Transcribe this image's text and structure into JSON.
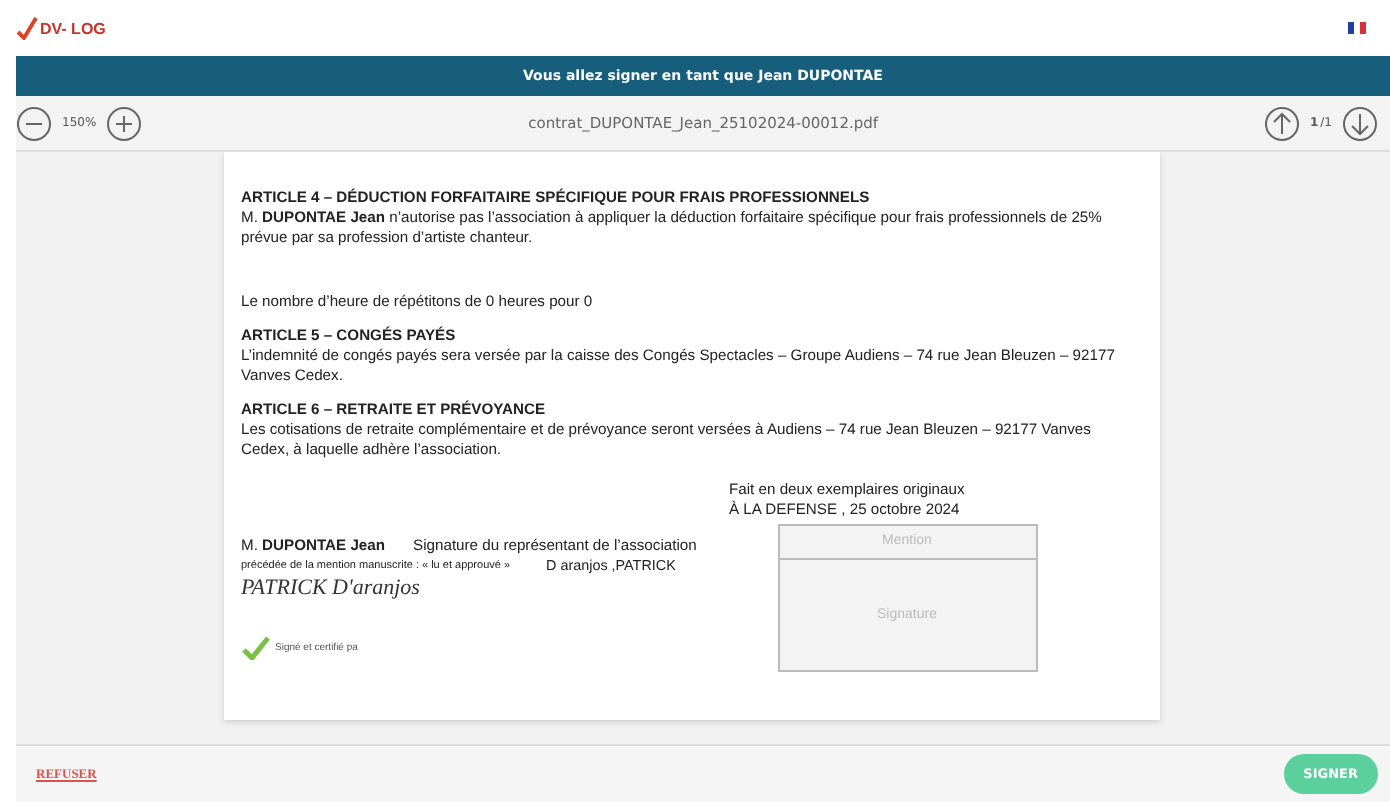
{
  "header": {
    "logo": "DV- LOG"
  },
  "banner": {
    "text": "Vous allez signer en tant que Jean DUPONTAE"
  },
  "toolbar": {
    "zoom": "150%",
    "filename": "contrat_DUPONTAE_Jean_25102024-00012.pdf",
    "page": "1",
    "page_total": "/1"
  },
  "document": {
    "blocks": [
      {
        "kind": "heading",
        "text": "ARTICLE 4 – DÉDUCTION FORFAITAIRE SPÉCIFIQUE POUR FRAIS PROFESSIONNELS"
      },
      {
        "kind": "paragraph",
        "text": "M.  **DUPONTAE Jean** n’autorise pas l’association à appliquer la déduction forfaitaire spécifique pour frais professionnels de 25% prévue par sa profession d’artiste chanteur."
      },
      {
        "kind": "spacer-paragraph",
        "text": "Le nombre d’heure de répétitons de 0 heures pour 0"
      },
      {
        "kind": "heading",
        "text": "ARTICLE 5 – CONGÉS PAYÉS"
      },
      {
        "kind": "paragraph",
        "text": "L’indemnité de congés payés sera versée par la caisse des Congés Spectacles – Groupe Audiens – 74 rue Jean Bleuzen – 92177 Vanves Cedex."
      },
      {
        "kind": "heading",
        "text": "ARTICLE 6 – RETRAITE ET PRÉVOYANCE"
      },
      {
        "kind": "paragraph",
        "text": "Les cotisations de retraite complémentaire et de prévoyance seront versées à Audiens – 74 rue Jean Bleuzen – 92177 Vanves Cedex, à laquelle adhère l’association."
      }
    ],
    "place_lines": [
      "Fait en deux exemplaires originaux",
      "À LA DEFENSE , 25 octobre 2024"
    ],
    "signatory": "M.  **DUPONTAE Jean**",
    "representative": "Signature du représentant de l’association",
    "mention_note": "précédée de la mention manuscrite : « lu et approuvé »",
    "representative_name": "D aranjos ,PATRICK",
    "handwriting": "PATRICK D'aranjos",
    "signature_field": {
      "mention_placeholder": "Mention",
      "signature_placeholder": "Signature"
    },
    "certified": {
      "text": "Signé et certifié pa",
      "checked": true
    }
  },
  "footer": {
    "refuse": "REFUSER",
    "sign": "SIGNER"
  }
}
